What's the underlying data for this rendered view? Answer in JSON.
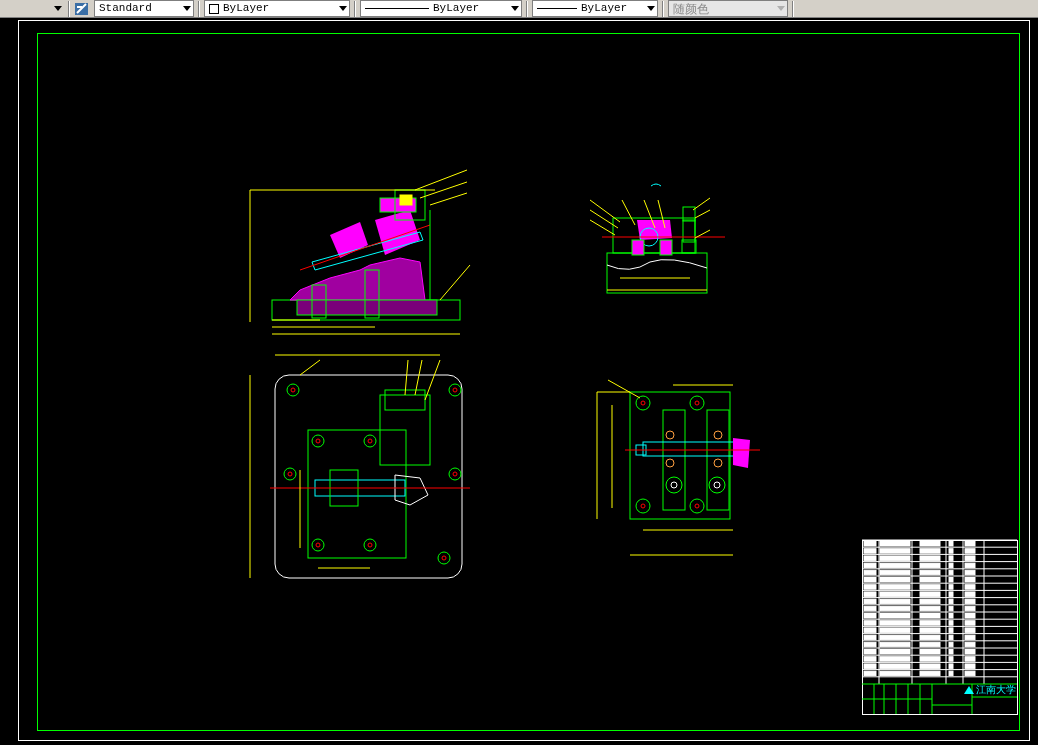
{
  "toolbar": {
    "items": [
      {
        "kind": "stub",
        "disabled": false
      },
      {
        "kind": "textstyle",
        "value": "Standard",
        "disabled": false
      },
      {
        "kind": "color",
        "value": "ByLayer",
        "disabled": false
      },
      {
        "kind": "linetype",
        "value": "ByLayer",
        "disabled": false
      },
      {
        "kind": "lineweight",
        "value": "ByLayer",
        "disabled": false
      },
      {
        "kind": "plotstyle",
        "value": "随颜色",
        "disabled": true
      }
    ]
  },
  "title_block": {
    "school": "江南大学"
  }
}
